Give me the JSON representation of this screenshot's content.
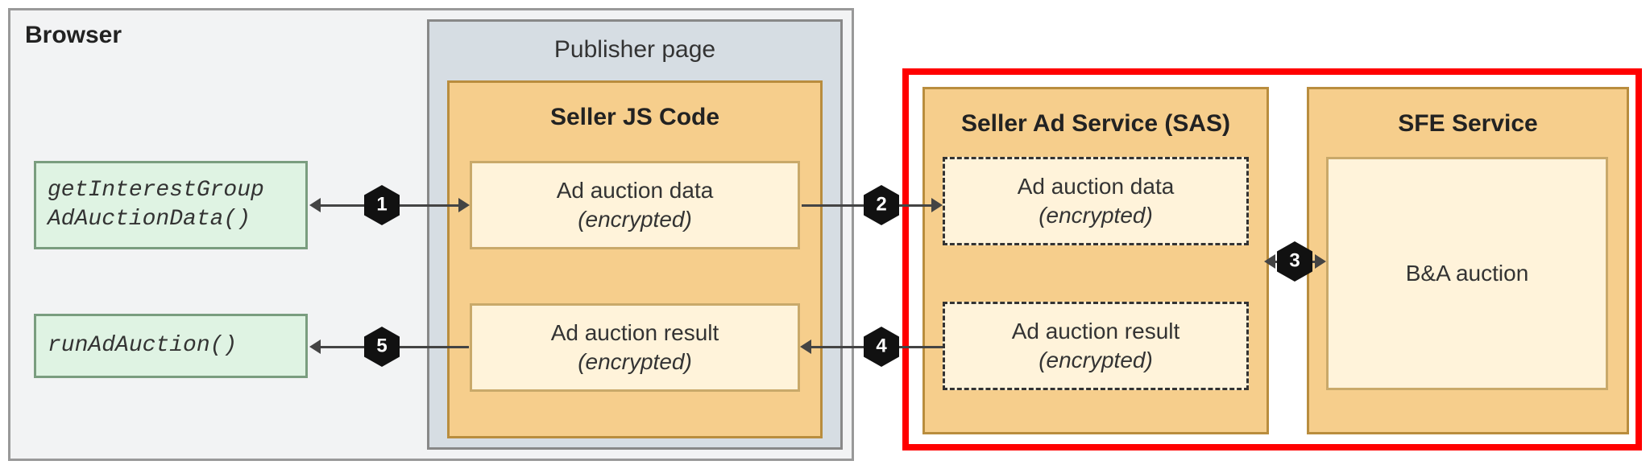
{
  "browser": {
    "label": "Browser",
    "api_get": "getInterestGroup\nAdAuctionData()",
    "api_run": "runAdAuction()"
  },
  "publisher": {
    "label": "Publisher page",
    "seller_js": {
      "label": "Seller JS Code",
      "data_box": {
        "title": "Ad auction data",
        "subtitle": "(encrypted)"
      },
      "result_box": {
        "title": "Ad auction result",
        "subtitle": "(encrypted)"
      }
    }
  },
  "sas": {
    "label": "Seller Ad Service (SAS)",
    "data_box": {
      "title": "Ad auction data",
      "subtitle": "(encrypted)"
    },
    "result_box": {
      "title": "Ad auction result",
      "subtitle": "(encrypted)"
    }
  },
  "sfe": {
    "label": "SFE Service",
    "auction_box": "B&A auction"
  },
  "steps": {
    "s1": "1",
    "s2": "2",
    "s3": "3",
    "s4": "4",
    "s5": "5"
  }
}
